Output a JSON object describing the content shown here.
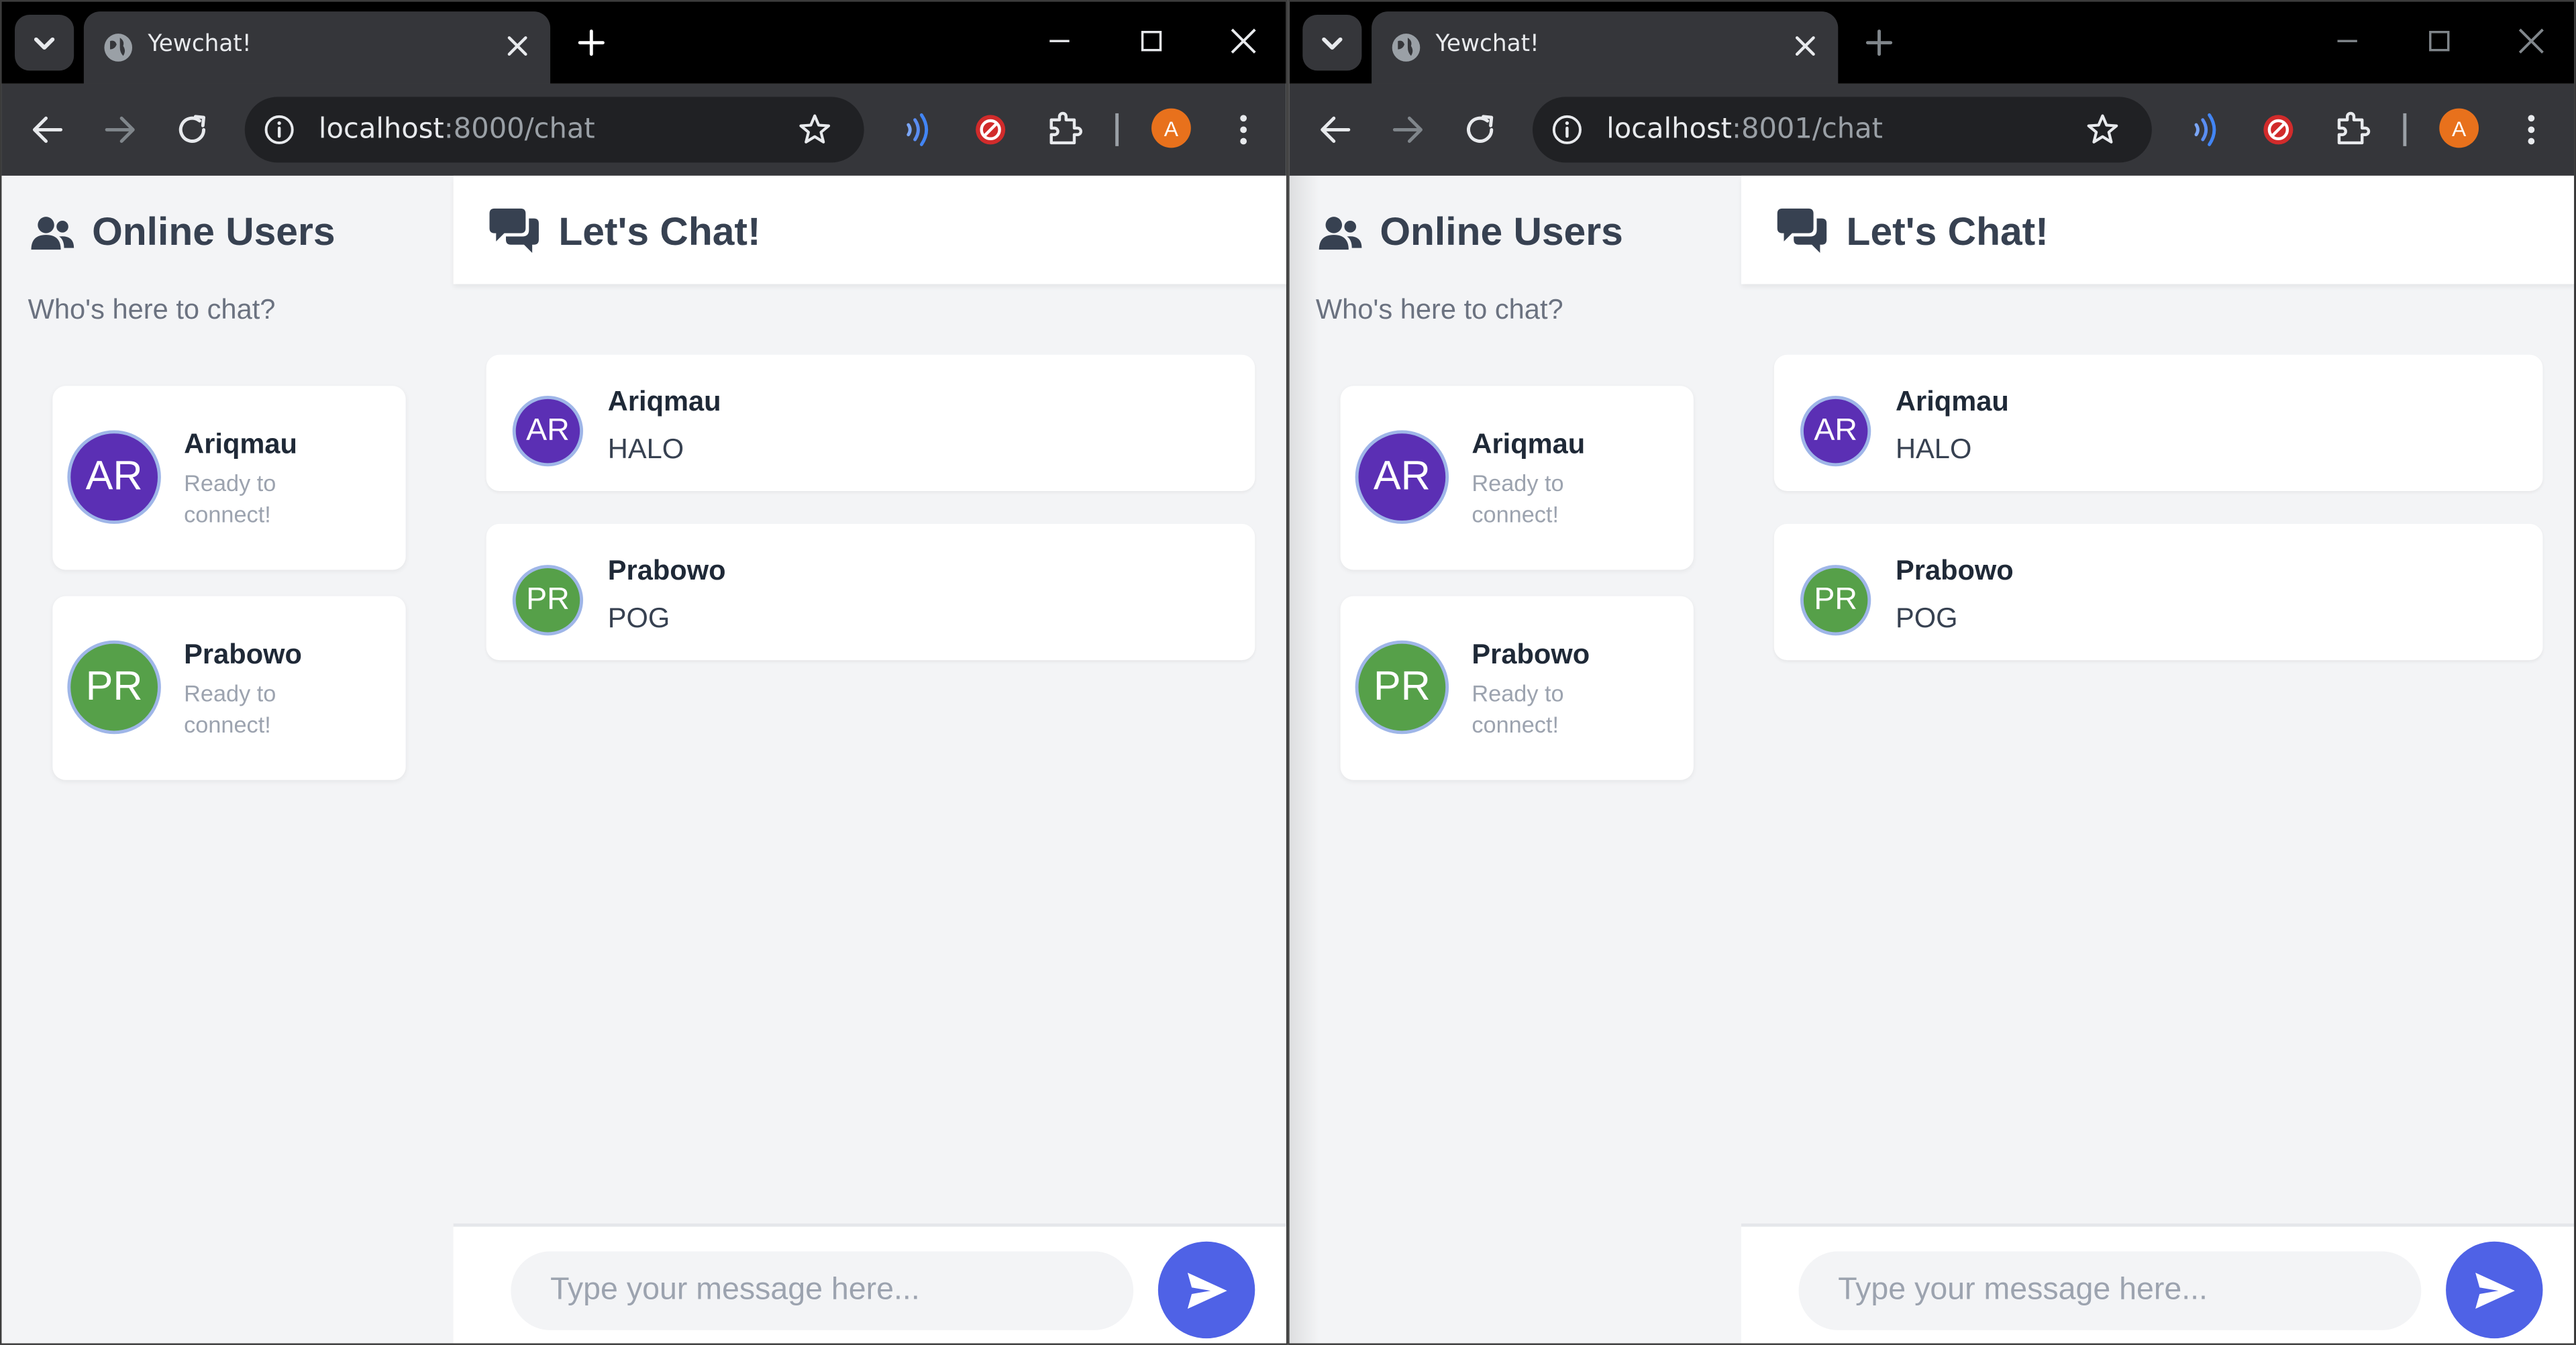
{
  "colors": {
    "avatar_ar": "#5b2fb4",
    "avatar_pr": "#56a049",
    "send_button": "#4f62e6",
    "profile_badge": "#e8711c"
  },
  "windows": [
    {
      "tab": {
        "title": "Yewchat!"
      },
      "address": {
        "host": "localhost",
        "rest": ":8000/chat"
      },
      "profile_initial": "A",
      "sidebar": {
        "title": "Online Users",
        "subtitle": "Who's here to chat?"
      },
      "users": [
        {
          "initials": "AR",
          "name": "Ariqmau",
          "status": "Ready to connect!"
        },
        {
          "initials": "PR",
          "name": "Prabowo",
          "status": "Ready to connect!"
        }
      ],
      "chat": {
        "title": "Let's Chat!",
        "messages": [
          {
            "initials": "AR",
            "name": "Ariqmau",
            "text": "HALO"
          },
          {
            "initials": "PR",
            "name": "Prabowo",
            "text": "POG"
          }
        ],
        "input_placeholder": "Type your message here..."
      }
    },
    {
      "tab": {
        "title": "Yewchat!"
      },
      "address": {
        "host": "localhost",
        "rest": ":8001/chat"
      },
      "profile_initial": "A",
      "sidebar": {
        "title": "Online Users",
        "subtitle": "Who's here to chat?"
      },
      "users": [
        {
          "initials": "AR",
          "name": "Ariqmau",
          "status": "Ready to connect!"
        },
        {
          "initials": "PR",
          "name": "Prabowo",
          "status": "Ready to connect!"
        }
      ],
      "chat": {
        "title": "Let's Chat!",
        "messages": [
          {
            "initials": "AR",
            "name": "Ariqmau",
            "text": "HALO"
          },
          {
            "initials": "PR",
            "name": "Prabowo",
            "text": "POG"
          }
        ],
        "input_placeholder": "Type your message here..."
      }
    }
  ]
}
